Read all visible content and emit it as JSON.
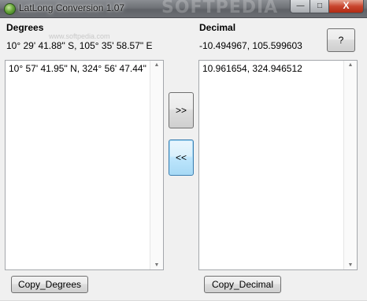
{
  "window": {
    "title": "LatLong Conversion 1.07",
    "watermark": "SOFTPEDIA",
    "controls": {
      "minimize": "—",
      "maximize": "□",
      "close": "X"
    }
  },
  "degrees": {
    "heading": "Degrees",
    "result": "10° 29' 41.88\" S, 105° 35' 58.57\" E",
    "input_value": "10° 57' 41.95\" N, 324° 56' 47.44\" E",
    "copy_label": "Copy_Degrees"
  },
  "decimal": {
    "heading": "Decimal",
    "result": "-10.494967, 105.599603",
    "input_value": "10.961654, 324.946512",
    "copy_label": "Copy_Decimal"
  },
  "buttons": {
    "help": "?",
    "to_decimal": ">>",
    "to_degrees": "<<"
  },
  "watermark_small": "www.softpedia.com"
}
